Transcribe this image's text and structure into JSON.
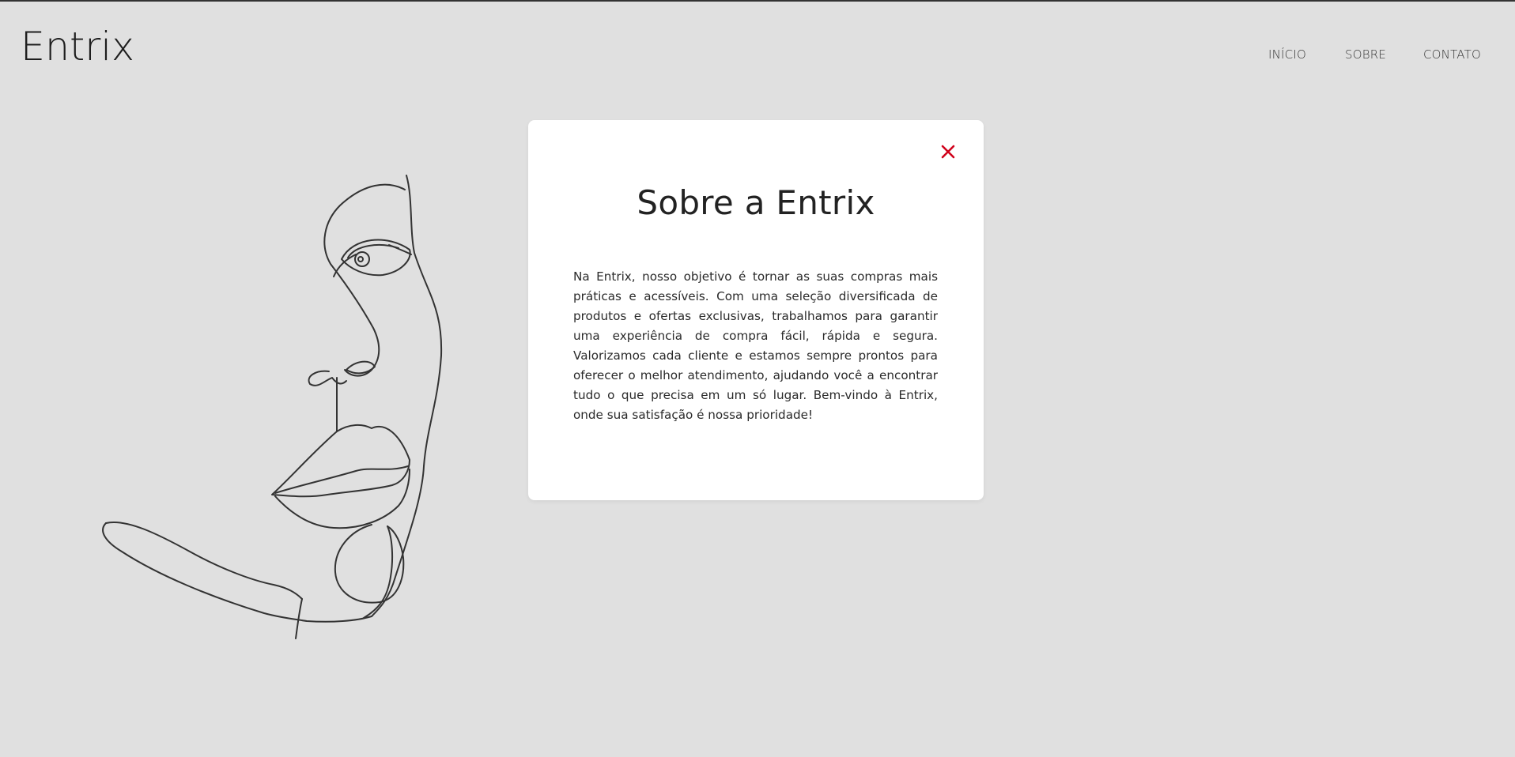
{
  "header": {
    "logo": "Entrix",
    "nav": [
      {
        "label": "INÍCIO"
      },
      {
        "label": "SOBRE"
      },
      {
        "label": "CONTATO"
      }
    ]
  },
  "modal": {
    "title": "Sobre a Entrix",
    "body": "Na Entrix, nosso objetivo é tornar as suas compras mais práticas e acessíveis. Com uma seleção diversificada de produtos e ofertas exclusivas, trabalhamos para garantir uma experiência de compra fácil, rápida e segura. Valorizamos cada cliente e estamos sempre prontos para oferecer o melhor atendimento, ajudando você a encontrar tudo o que precisa em um só lugar. Bem-vindo à Entrix, onde sua satisfação é nossa prioridade!",
    "close_icon": "close-icon",
    "close_color": "#d0021b"
  },
  "colors": {
    "background": "#e0e0e0",
    "text": "#222222",
    "line_art": "#333333"
  },
  "illustration": {
    "icon": "line-art-face-icon"
  }
}
